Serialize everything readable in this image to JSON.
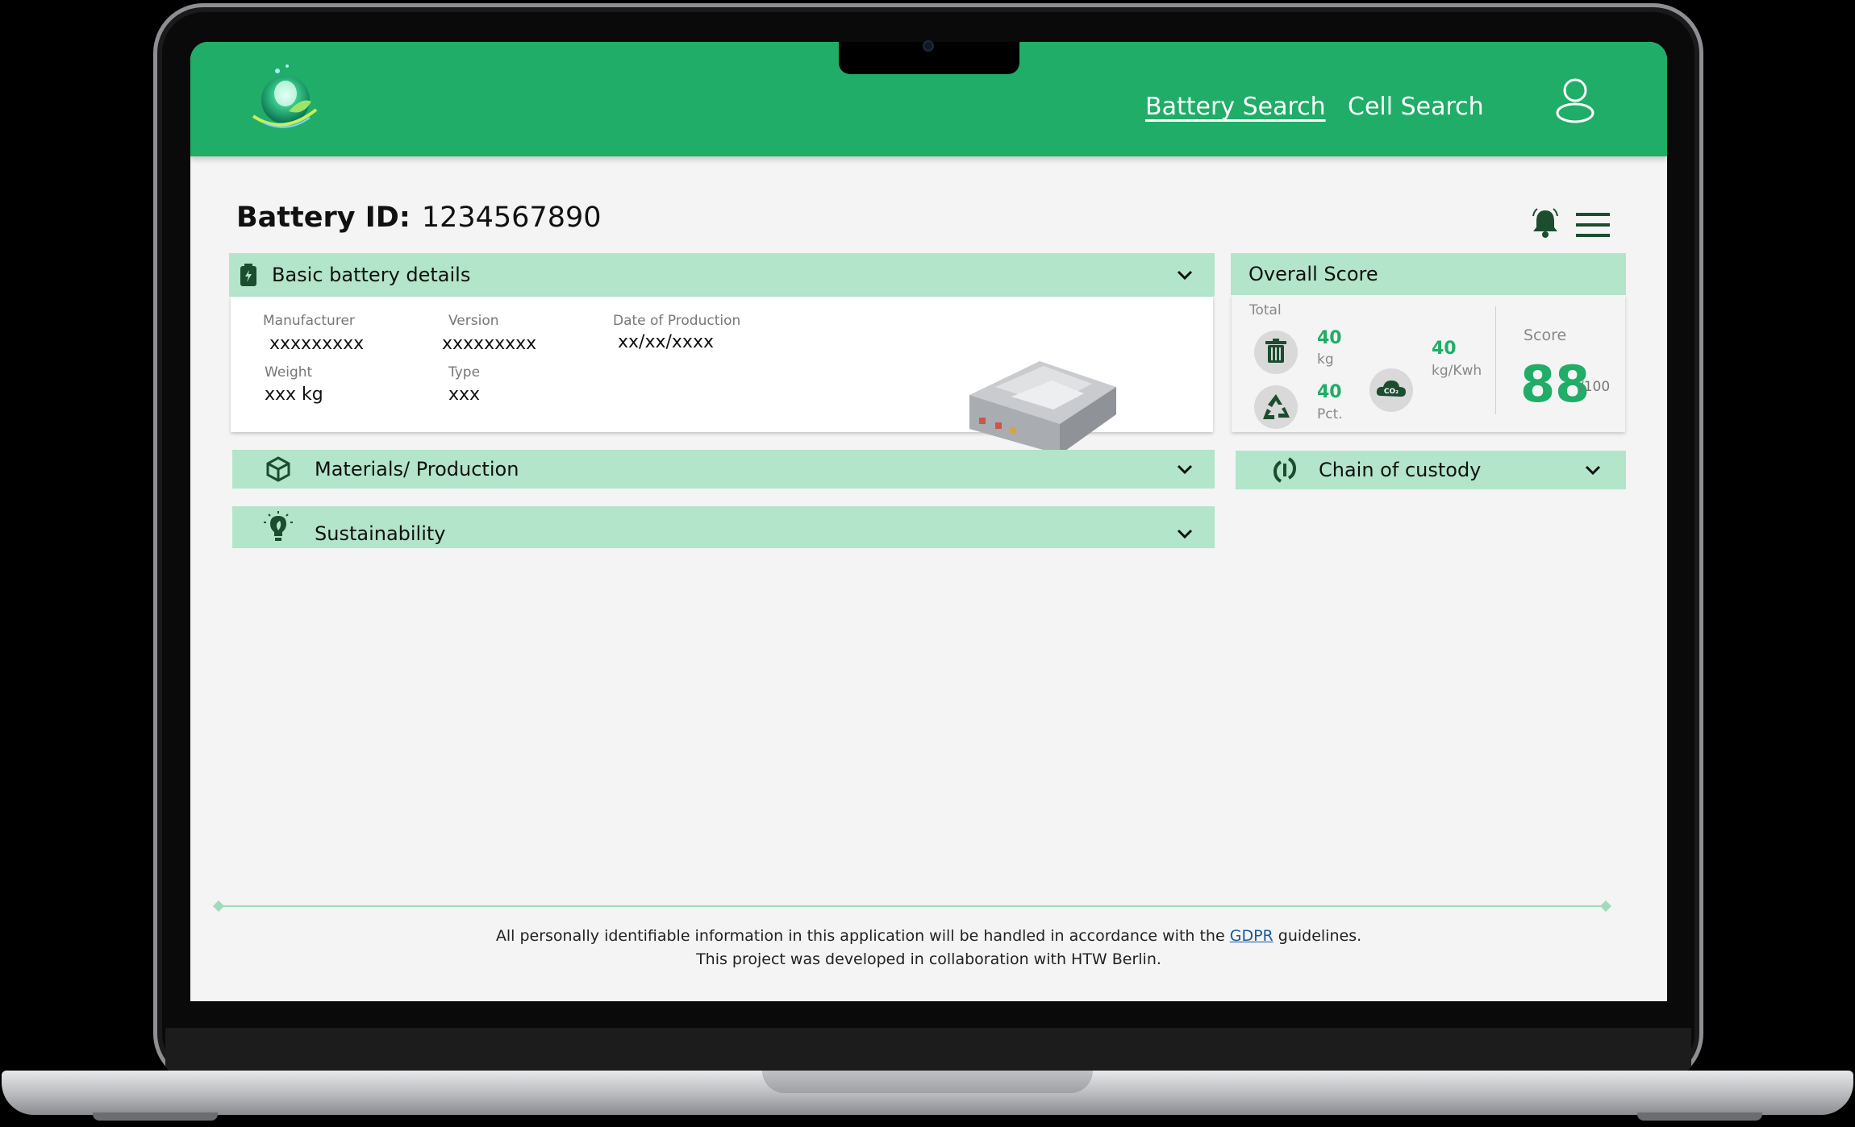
{
  "header": {
    "nav": [
      {
        "label": "Battery Search",
        "active": true
      },
      {
        "label": "Cell Search",
        "active": false
      }
    ],
    "logo_icon": "leaf-globe-logo",
    "user_icon": "user-icon"
  },
  "battery": {
    "id_label": "Battery ID:",
    "id_value": "1234567890"
  },
  "basic_details": {
    "title": "Basic battery details",
    "icon": "battery-icon",
    "fields": {
      "manufacturer_label": "Manufacturer",
      "manufacturer_value": "xxxxxxxxx",
      "version_label": "Version",
      "version_value": "xxxxxxxxx",
      "date_label": "Date of Production",
      "date_value": "xx/xx/xxxx",
      "weight_label": "Weight",
      "weight_value": "xxx kg",
      "type_label": "Type",
      "type_value": "xxx"
    }
  },
  "overall_score": {
    "title": "Overall Score",
    "total_label": "Total",
    "waste_value": "40",
    "waste_unit": "kg",
    "recycle_value": "40",
    "recycle_unit": "Pct.",
    "co2_value": "40",
    "co2_unit": "kg/Kwh",
    "score_label": "Score",
    "score_value": "88",
    "score_max": "/100"
  },
  "sections": {
    "materials": "Materials/ Production",
    "sustainability": "Sustainability",
    "chain": "Chain of custody"
  },
  "footer": {
    "line1_before": "All personally identifiable information in this application will be handled in accordance with the ",
    "line1_link": "GDPR",
    "line1_after": " guidelines.",
    "line2": "This project was developed in collaboration with HTW Berlin."
  },
  "colors": {
    "brand_green": "#20ad67",
    "panel_green": "#b2e5c9",
    "dark_green": "#1b4d2e"
  }
}
